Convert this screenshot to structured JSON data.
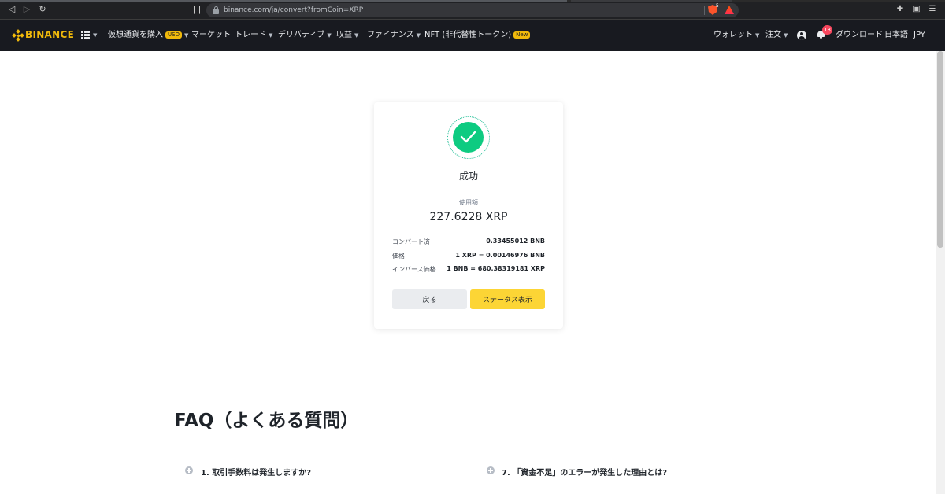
{
  "browser": {
    "url": "binance.com/ja/convert?fromCoin=XRP",
    "shield_count": "5"
  },
  "header": {
    "logo_text": "BINANCE",
    "nav": {
      "buy_crypto": "仮想通貨を購入",
      "buy_crypto_badge": "USD",
      "markets": "マーケット",
      "trade": "トレード",
      "derivatives": "デリバティブ",
      "earn": "収益",
      "finance": "ファイナンス",
      "nft": "NFT (非代替性トークン)",
      "nft_badge": "New"
    },
    "right": {
      "wallet": "ウォレット",
      "orders": "注文",
      "notification_count": "13",
      "download": "ダウンロード",
      "language": "日本語",
      "currency": "JPY"
    }
  },
  "result": {
    "title": "成功",
    "amount_label": "使用額",
    "amount_value": "227.6228 XRP",
    "rows": [
      {
        "label": "コンバート済",
        "value": "0.33455012 BNB"
      },
      {
        "label": "価格",
        "value": "1 XRP = 0.00146976 BNB"
      },
      {
        "label": "インバース価格",
        "value": "1 BNB = 680.38319181 XRP"
      }
    ],
    "back_label": "戻る",
    "status_label": "ステータス表示"
  },
  "faq": {
    "title": "FAQ（よくある質問）",
    "items": [
      {
        "text": "1. 取引手数料は発生しますか?"
      },
      {
        "text": "7. 「資金不足」のエラーが発生した理由とは?"
      }
    ]
  },
  "colors": {
    "brand": "#f0b90b",
    "success": "#0ecb81",
    "primary_button": "#fcd535",
    "header_bg": "#181a20"
  }
}
